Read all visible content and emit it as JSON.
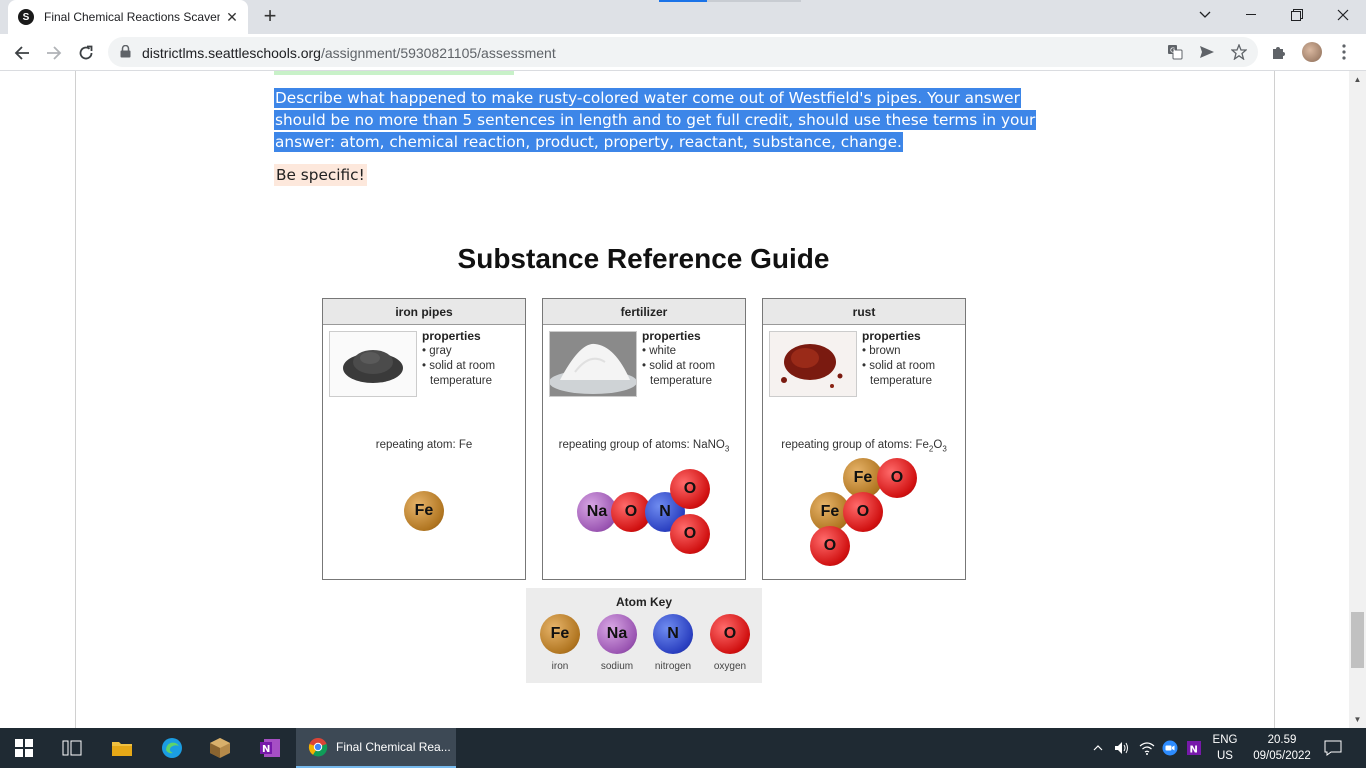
{
  "browser": {
    "tab_title": "Final Chemical Reactions Scaveng",
    "tab_favicon_letter": "S",
    "url_host": "districtlms.seattleschools.org",
    "url_path": "/assignment/5930821105/assessment"
  },
  "page": {
    "question_text": "Describe what happened to make rusty-colored water come out of Westfield's pipes.    Your answer should be no more than 5 sentences in length and to get full credit, should use these terms in your answer:  atom, chemical reaction, product, property, reactant, substance, change.",
    "be_specific": "Be specific!"
  },
  "guide": {
    "title": "Substance Reference Guide",
    "cards": [
      {
        "name": "iron pipes",
        "properties_heading": "properties",
        "prop1": "• gray",
        "prop2": "• solid at room temperature",
        "repeat_label": "repeating atom: Fe",
        "atoms": [
          "Fe"
        ]
      },
      {
        "name": "fertilizer",
        "properties_heading": "properties",
        "prop1": "• white",
        "prop2": "• solid at room temperature",
        "repeat_label": "repeating group of atoms: NaNO",
        "repeat_sub": "3",
        "atoms": [
          "Na",
          "O",
          "N",
          "O",
          "O"
        ]
      },
      {
        "name": "rust",
        "properties_heading": "properties",
        "prop1": "• brown",
        "prop2": "• solid at room temperature",
        "repeat_label": "repeating group of atoms: Fe",
        "repeat_sub1": "2",
        "repeat_mid": "O",
        "repeat_sub2": "3",
        "atoms": [
          "Fe",
          "O",
          "Fe",
          "O",
          "O"
        ]
      }
    ],
    "atom_key": {
      "title": "Atom Key",
      "items": [
        {
          "symbol": "Fe",
          "name": "iron"
        },
        {
          "symbol": "Na",
          "name": "sodium"
        },
        {
          "symbol": "N",
          "name": "nitrogen"
        },
        {
          "symbol": "O",
          "name": "oxygen"
        }
      ]
    }
  },
  "taskbar": {
    "chrome_label": "Final Chemical Rea...",
    "lang_top": "ENG",
    "lang_bottom": "US",
    "time": "20.59",
    "date": "09/05/2022"
  },
  "colors": {
    "selection": "#3d86e8",
    "iron": "#b07520",
    "sodium": "#9a55b2",
    "nitrogen": "#2a3fc0",
    "oxygen": "#d01010"
  }
}
